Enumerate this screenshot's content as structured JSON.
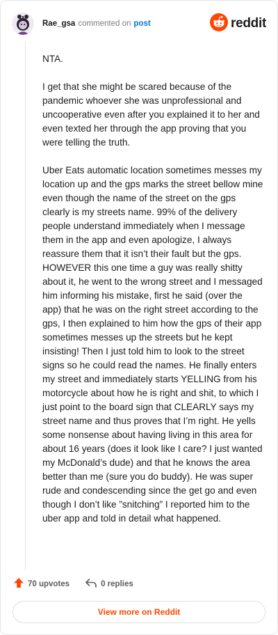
{
  "header": {
    "username": "Rae_gsa",
    "action": "commented on",
    "post_link": "post",
    "brand": "reddit"
  },
  "comment": {
    "paragraphs": [
      "NTA.",
      "I get that she might be scared because of the pandemic whoever she was unprofessional and uncooperative even after you explained it to her and even texted her through the app proving that you were telling the truth.",
      "Uber Eats automatic location sometimes messes my location up and the gps marks the street bellow mine even though the name of the street on the gps clearly is my streets name. 99% of the delivery people understand immediately when I message them in the app and even apologize, I always reassure them that it isn’t their fault but the gps. HOWEVER this one time a guy was really shitty about it, he went to the wrong street and I messaged him informing his mistake, first he said (over the app) that he was on the right street according to the gps, I then explained to him how the gps of their app sometimes messes up the streets but he kept insisting! Then I just told him to look to the street signs so he could read the names. He finally enters my street and immediately starts YELLING from his motorcycle about how he is right and shit, to which I just point to the board sign that CLEARLY says my street name and thus proves that I’m right. He yells some nonsense about having living in this area for about 16 years (does it look like I care? I just wanted my McDonald’s dude) and that he knows the area better than me (sure you do buddy). He was super rude and condescending since the get go and even though I don’t like ”snitching” I reported him to the uber app and told in detail what happened."
    ]
  },
  "actions": {
    "upvotes": "70 upvotes",
    "replies": "0 replies"
  },
  "footer": {
    "view_more": "View more on Reddit"
  },
  "colors": {
    "brand_orange": "#ff4500",
    "link_blue": "#0079d3"
  },
  "icons": [
    "avatar",
    "reddit-logo-icon",
    "upvote-icon",
    "reply-icon"
  ]
}
